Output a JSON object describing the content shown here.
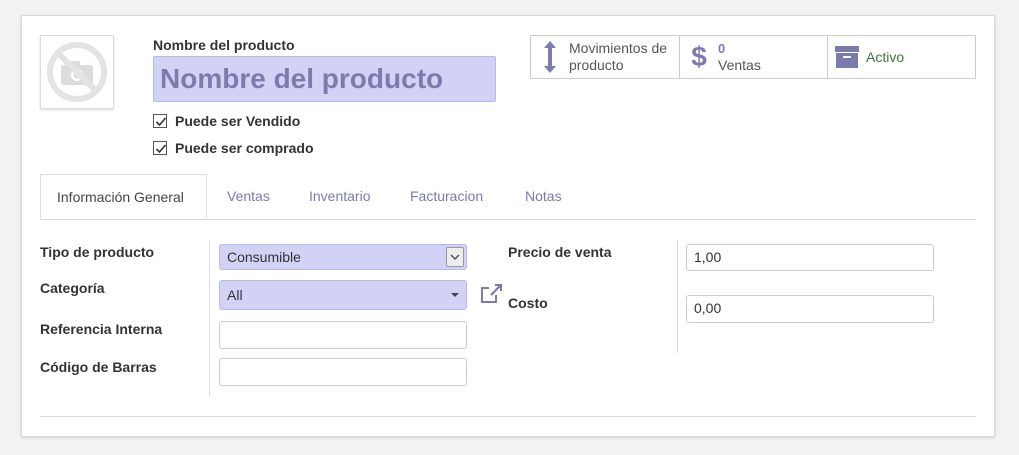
{
  "header": {
    "name_label": "Nombre del producto",
    "name_placeholder": "Nombre del producto",
    "can_be_sold": "Puede ser Vendido",
    "can_be_purchased": "Puede ser comprado"
  },
  "stats": {
    "moves": {
      "line1": "Movimientos de",
      "line2": "producto"
    },
    "sales": {
      "count": "0",
      "label": "Ventas"
    },
    "active": {
      "label": "Activo"
    }
  },
  "tabs": [
    "Información General",
    "Ventas",
    "Inventario",
    "Facturacion",
    "Notas"
  ],
  "form": {
    "product_type_label": "Tipo de producto",
    "product_type_value": "Consumible",
    "category_label": "Categoría",
    "category_value": "All",
    "internal_ref_label": "Referencia Interna",
    "internal_ref_value": "",
    "barcode_label": "Código de Barras",
    "barcode_value": "",
    "sale_price_label": "Precio de venta",
    "sale_price_value": "1,00",
    "cost_label": "Costo",
    "cost_value": "0,00"
  },
  "colors": {
    "accent": "#7c7bad",
    "required_bg": "#d2d2f7",
    "active_green": "#3c763d"
  }
}
